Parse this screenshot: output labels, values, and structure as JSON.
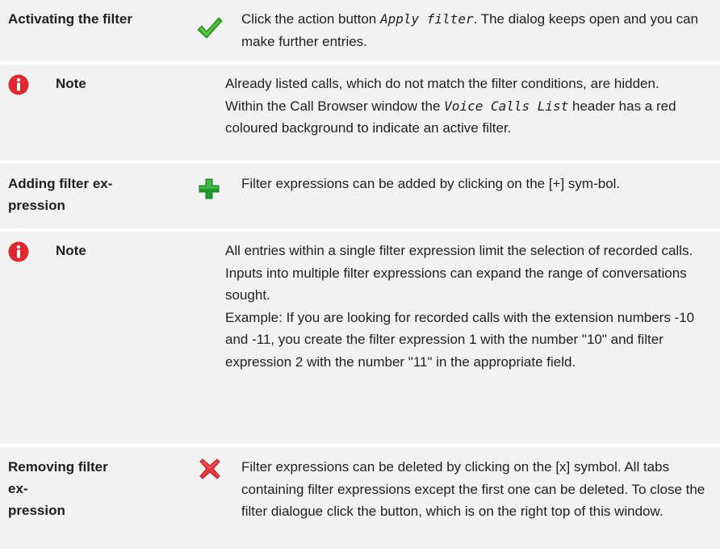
{
  "rows": {
    "activating": {
      "label": "Activating the filter",
      "text_pre": "Click the action button ",
      "text_code": "Apply filter",
      "text_post": ". The dialog keeps open and you can make further entries."
    },
    "note1": {
      "label": "Note",
      "line1": "Already listed calls, which do not match the filter conditions, are hidden.",
      "line2_pre": "Within the Call Browser window the ",
      "line2_code": "Voice Calls List",
      "line2_post": " header has a red coloured background to indicate an active filter."
    },
    "adding": {
      "label_line1": "Adding filter ex-",
      "label_line2": "pression",
      "text": "Filter expressions can be added by clicking on the [+] sym-bol."
    },
    "note2": {
      "label": "Note",
      "para1": "All entries within a single filter expression limit the selection of recorded calls.",
      "para2": "Inputs into multiple filter expressions can expand the range of conversations sought.",
      "para3": "Example: If you are looking for recorded calls with the extension numbers -10 and -11, you create the filter expression 1 with the number \"10\" and filter expression 2 with the number \"11\" in the appropriate field."
    },
    "removing": {
      "label_line1": "Removing filter ex-",
      "label_line2": "pression",
      "text": "Filter expressions can be deleted by clicking on the [x] symbol. All tabs containing filter expressions except the first one can be deleted. To close the filter dialogue click the button, which is on the right top of this window."
    }
  },
  "icons": {
    "check": "checkmark-icon",
    "info": "info-icon",
    "plus": "plus-icon",
    "cross": "cross-icon"
  },
  "colors": {
    "row_bg": "#f2f2f2",
    "check_green": "#3cab2a",
    "info_red": "#e0262e",
    "plus_green": "#1e9a2a",
    "cross_red": "#e8343a"
  }
}
